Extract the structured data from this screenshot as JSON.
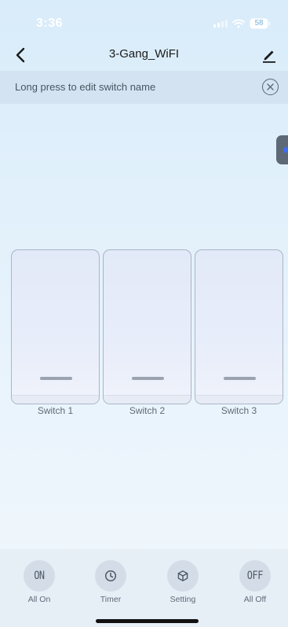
{
  "status_bar": {
    "time": "3:36",
    "battery": "58",
    "icons": [
      "signal-icon",
      "wifi-icon",
      "battery-icon"
    ]
  },
  "nav": {
    "title": "3-Gang_WiFI",
    "back_icon": "chevron-left-icon",
    "edit_icon": "pencil-icon"
  },
  "hint": {
    "text": "Long press to edit switch name",
    "close_icon": "close-circle-icon"
  },
  "switches": [
    {
      "label": "Switch 1"
    },
    {
      "label": "Switch 2"
    },
    {
      "label": "Switch 3"
    }
  ],
  "toolbar": {
    "all_on": {
      "glyph": "ON",
      "label": "All On"
    },
    "timer": {
      "icon": "clock-icon",
      "label": "Timer"
    },
    "setting": {
      "icon": "cube-icon",
      "label": "Setting"
    },
    "all_off": {
      "glyph": "OFF",
      "label": "All Off"
    }
  },
  "colors": {
    "background_top": "#d9ecfa",
    "banner": "#d3e3f1",
    "switch_border": "#a9b5c8",
    "handle": "#5d6976",
    "handle_accent": "#3f6cf0",
    "toolbar_bg": "#e6eef6"
  }
}
